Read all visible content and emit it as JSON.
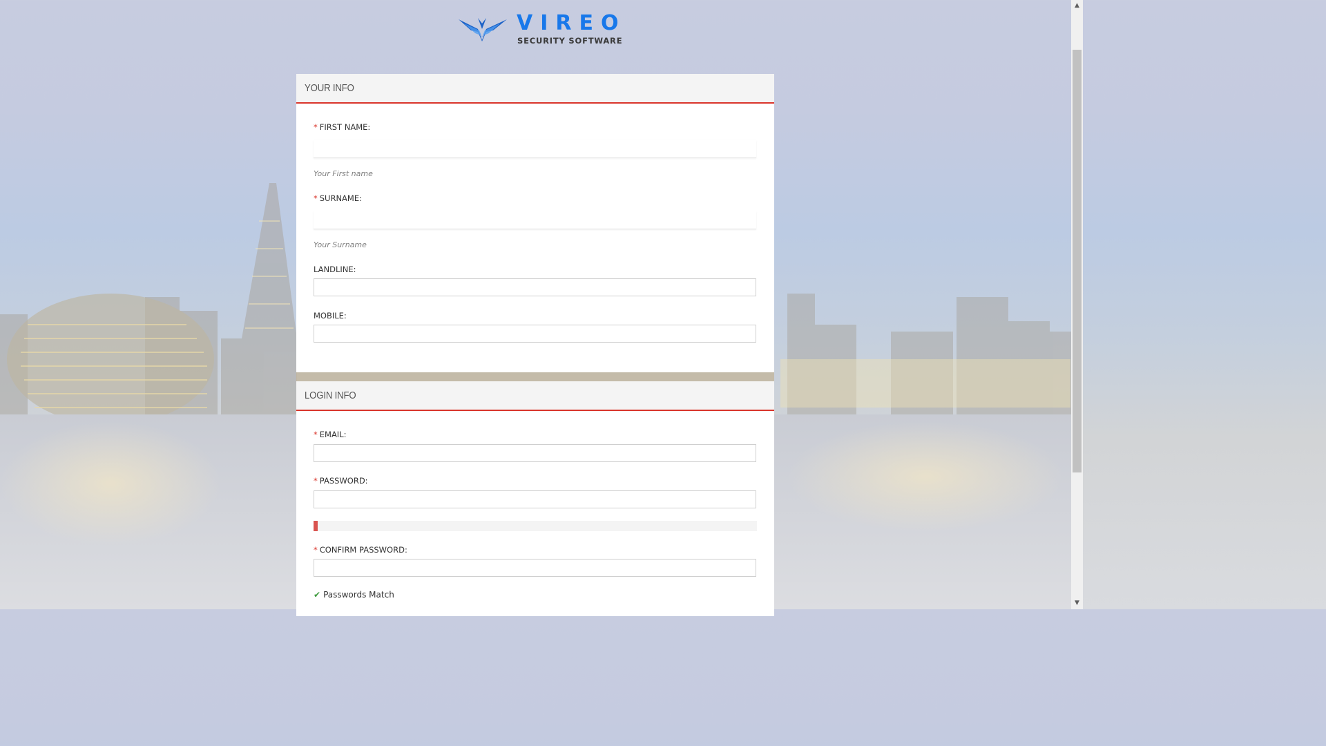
{
  "brand": {
    "name": "VIREO",
    "tagline": "SECURITY SOFTWARE",
    "color": "#1878ea"
  },
  "colors": {
    "accent_red": "#d9352b",
    "success_green": "#3c9a3c"
  },
  "your_info": {
    "title": "YOUR INFO",
    "required_marker": "*",
    "fields": {
      "first_name": {
        "label": "FIRST NAME:",
        "value": "",
        "help": "Your First name",
        "required": true
      },
      "surname": {
        "label": "SURNAME:",
        "value": "",
        "help": "Your Surname",
        "required": true
      },
      "landline": {
        "label": "LANDLINE:",
        "value": "",
        "required": false
      },
      "mobile": {
        "label": "MOBILE:",
        "value": "",
        "required": false
      }
    }
  },
  "login_info": {
    "title": "LOGIN INFO",
    "required_marker": "*",
    "fields": {
      "email": {
        "label": "EMAIL:",
        "value": "",
        "required": true
      },
      "password": {
        "label": "PASSWORD:",
        "value": "",
        "required": true
      },
      "confirm_password": {
        "label": "CONFIRM PASSWORD:",
        "value": "",
        "required": true
      }
    },
    "password_strength": 0.01,
    "match_message": "Passwords Match",
    "match_icon": "check-icon"
  },
  "scrollbar": {
    "up_icon": "scroll-up-arrow-icon",
    "down_icon": "scroll-down-arrow-icon"
  }
}
